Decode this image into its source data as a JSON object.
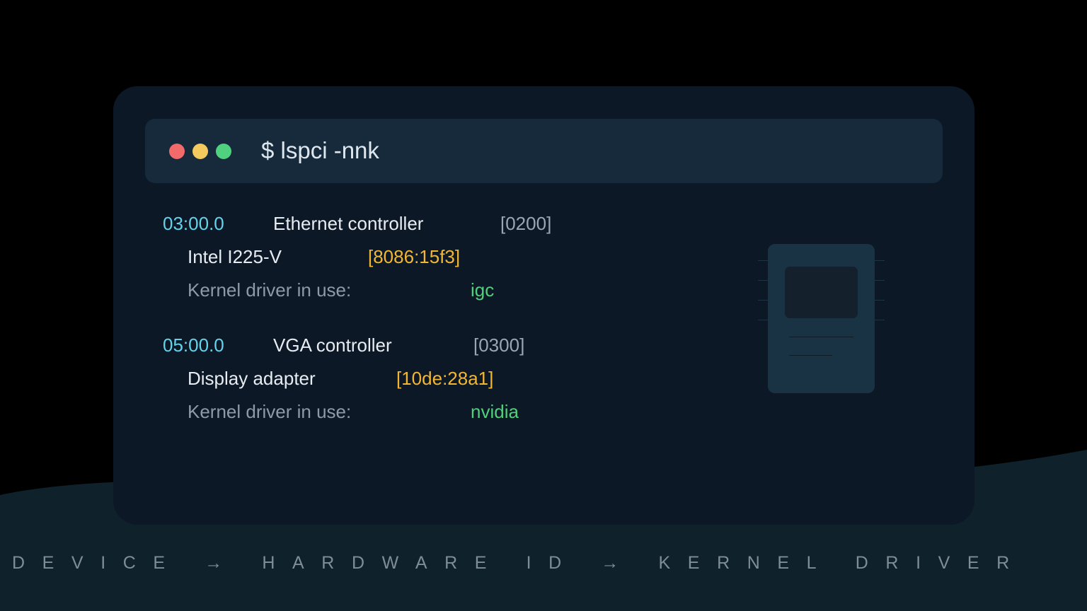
{
  "window": {
    "controls": {
      "close_color": "#f26a6a",
      "minimize_color": "#f4c95d",
      "maximize_color": "#4fd17f"
    },
    "command": "$ lspci -nnk"
  },
  "devices": [
    {
      "address": "03:00.0",
      "class_name": "Ethernet controller",
      "class_code": "[0200]",
      "device_name": "Intel I225-V",
      "hardware_id": "[8086:15f3]",
      "driver_label": "Kernel driver in use:",
      "driver": "igc"
    },
    {
      "address": "05:00.0",
      "class_name": "VGA controller",
      "class_code": "[0300]",
      "device_name": "Display adapter",
      "hardware_id": "[10de:28a1]",
      "driver_label": "Kernel driver in use:",
      "driver": "nvidia"
    }
  ],
  "illustration": {
    "icon": "pci-card-icon"
  },
  "footer": {
    "caption": "DEVICE → HARDWARE ID → KERNEL DRIVER"
  },
  "colors": {
    "background": "#000000",
    "card": "#0d1826",
    "titlebar": "#162a3b",
    "address": "#63d3ec",
    "hardware_id": "#f3b632",
    "driver": "#50cf7c"
  }
}
